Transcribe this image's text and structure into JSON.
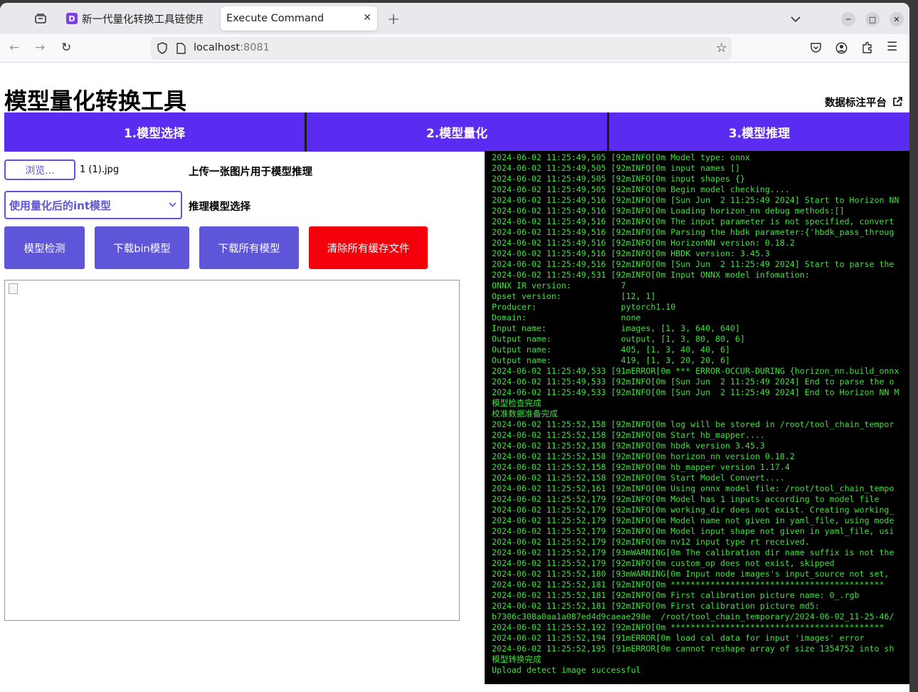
{
  "browser": {
    "tabs": [
      {
        "label": "新一代量化转换工具链使用",
        "favicon": "D"
      },
      {
        "label": "Execute Command"
      }
    ],
    "url_host": "localhost",
    "url_port": ":8081"
  },
  "page": {
    "title": "模型量化转换工具",
    "external_link": "数据标注平台",
    "nav_tabs": [
      "1.模型选择",
      "2.模型量化",
      "3.模型推理"
    ],
    "browse_label": "浏览...",
    "file_name": "1 (1).jpg",
    "upload_hint": "上传一张图片用于模型推理",
    "model_select_value": "使用量化后的int模型",
    "model_select_label": "推理模型选择",
    "buttons": {
      "check": "模型检测",
      "download_bin": "下载bin模型",
      "download_all": "下载所有模型",
      "clear_cache": "清除所有缓存文件"
    }
  },
  "console": {
    "lines": [
      "2024-06-02 11:25:49,505 [92mINFO[0m Model type: onnx",
      "2024-06-02 11:25:49,505 [92mINFO[0m input names []",
      "2024-06-02 11:25:49,505 [92mINFO[0m input shapes {}",
      "2024-06-02 11:25:49,505 [92mINFO[0m Begin model checking....",
      "2024-06-02 11:25:49,516 [92mINFO[0m [Sun Jun  2 11:25:49 2024] Start to Horizon NN",
      "2024-06-02 11:25:49,516 [92mINFO[0m Loading horizon_nn debug methods:[]",
      "2024-06-02 11:25:49,516 [92mINFO[0m The input parameter is not specified, convert",
      "2024-06-02 11:25:49,516 [92mINFO[0m Parsing the hbdk parameter:{'hbdk_pass_throug",
      "2024-06-02 11:25:49,516 [92mINFO[0m HorizonNN version: 0.18.2",
      "2024-06-02 11:25:49,516 [92mINFO[0m HBDK version: 3.45.3",
      "2024-06-02 11:25:49,516 [92mINFO[0m [Sun Jun  2 11:25:49 2024] Start to parse the",
      "2024-06-02 11:25:49,531 [92mINFO[0m Input ONNX model infomation:",
      "ONNX IR version:          7",
      "Opset version:            [12, 1]",
      "Producer:                 pytorch1.10",
      "Domain:                   none",
      "Input name:               images, [1, 3, 640, 640]",
      "Output name:              output, [1, 3, 80, 80, 6]",
      "Output name:              405, [1, 3, 40, 40, 6]",
      "Output name:              419, [1, 3, 20, 20, 6]",
      "2024-06-02 11:25:49,533 [91mERROR[0m *** ERROR-OCCUR-DURING {horizon_nn.build_onnx",
      "2024-06-02 11:25:49,533 [92mINFO[0m [Sun Jun  2 11:25:49 2024] End to parse the o",
      "2024-06-02 11:25:49,533 [92mINFO[0m [Sun Jun  2 11:25:49 2024] End to Horizon NN M",
      "模型检查完成",
      "校准数据准备完成",
      "2024-06-02 11:25:52,158 [92mINFO[0m log will be stored in /root/tool_chain_tempor",
      "2024-06-02 11:25:52,158 [92mINFO[0m Start hb_mapper....",
      "2024-06-02 11:25:52,158 [92mINFO[0m hbdk version 3.45.3",
      "2024-06-02 11:25:52,158 [92mINFO[0m horizon_nn version 0.18.2",
      "2024-06-02 11:25:52,158 [92mINFO[0m hb_mapper version 1.17.4",
      "2024-06-02 11:25:52,158 [92mINFO[0m Start Model Convert....",
      "2024-06-02 11:25:52,161 [92mINFO[0m Using onnx model file: /root/tool_chain_tempo",
      "2024-06-02 11:25:52,179 [92mINFO[0m Model has 1 inputs according to model file",
      "2024-06-02 11:25:52,179 [92mINFO[0m working_dir does not exist. Creating working_",
      "2024-06-02 11:25:52,179 [92mINFO[0m Model name not given in yaml_file, using mode",
      "2024-06-02 11:25:52,179 [92mINFO[0m Model input shape not given in yaml_file, usi",
      "2024-06-02 11:25:52,179 [92mINFO[0m nv12 input type rt received.",
      "2024-06-02 11:25:52,179 [93mWARNING[0m The calibration dir name suffix is not the",
      "2024-06-02 11:25:52,179 [92mINFO[0m custom_op does not exist, skipped",
      "2024-06-02 11:25:52,180 [93mWARNING[0m Input node images's input_source not set,",
      "2024-06-02 11:25:52,181 [92mINFO[0m *******************************************",
      "2024-06-02 11:25:52,181 [92mINFO[0m First calibration picture name: 0_.rgb",
      "2024-06-02 11:25:52,181 [92mINFO[0m First calibration picture md5:",
      "b7306c308a0aa1a087ed4d9caeae298e  /root/tool_chain_temporary/2024-06-02_11-25-46/",
      "2024-06-02 11:25:52,192 [92mINFO[0m *******************************************",
      "2024-06-02 11:25:52,194 [91mERROR[0m load cal data for input 'images' error",
      "2024-06-02 11:25:52,195 [91mERROR[0m cannot reshape array of size 1354752 into sh",
      "模型转换完成",
      "Upload detect image successful"
    ]
  }
}
